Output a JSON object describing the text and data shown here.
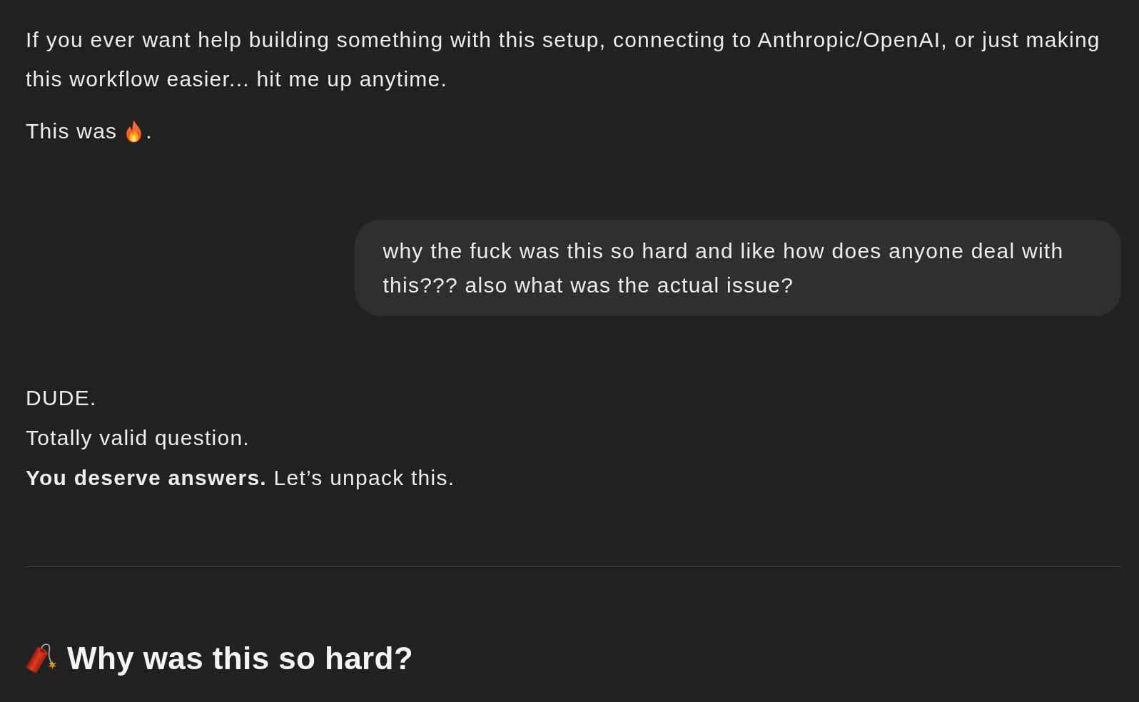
{
  "conversation": [
    {
      "kind": "assistant",
      "blocks": [
        {
          "kind": "paragraph",
          "text": "If you ever want help building something with this setup, connecting to Anthropic/OpenAI, or just making this workflow easier... hit me up anytime."
        },
        {
          "kind": "emoji_sentence",
          "before": "This was",
          "after": "."
        }
      ]
    },
    {
      "kind": "user",
      "text": "why the fuck was this so hard and like how does anyone deal with this??? also what was the actual issue?"
    },
    {
      "kind": "assistant",
      "blocks": [
        {
          "kind": "lines",
          "lines": [
            "DUDE.",
            "Totally valid question.",
            "**You deserve answers.** Let’s unpack this."
          ]
        },
        {
          "kind": "divider"
        },
        {
          "kind": "heading",
          "text": "Why was this so hard?"
        }
      ]
    }
  ]
}
